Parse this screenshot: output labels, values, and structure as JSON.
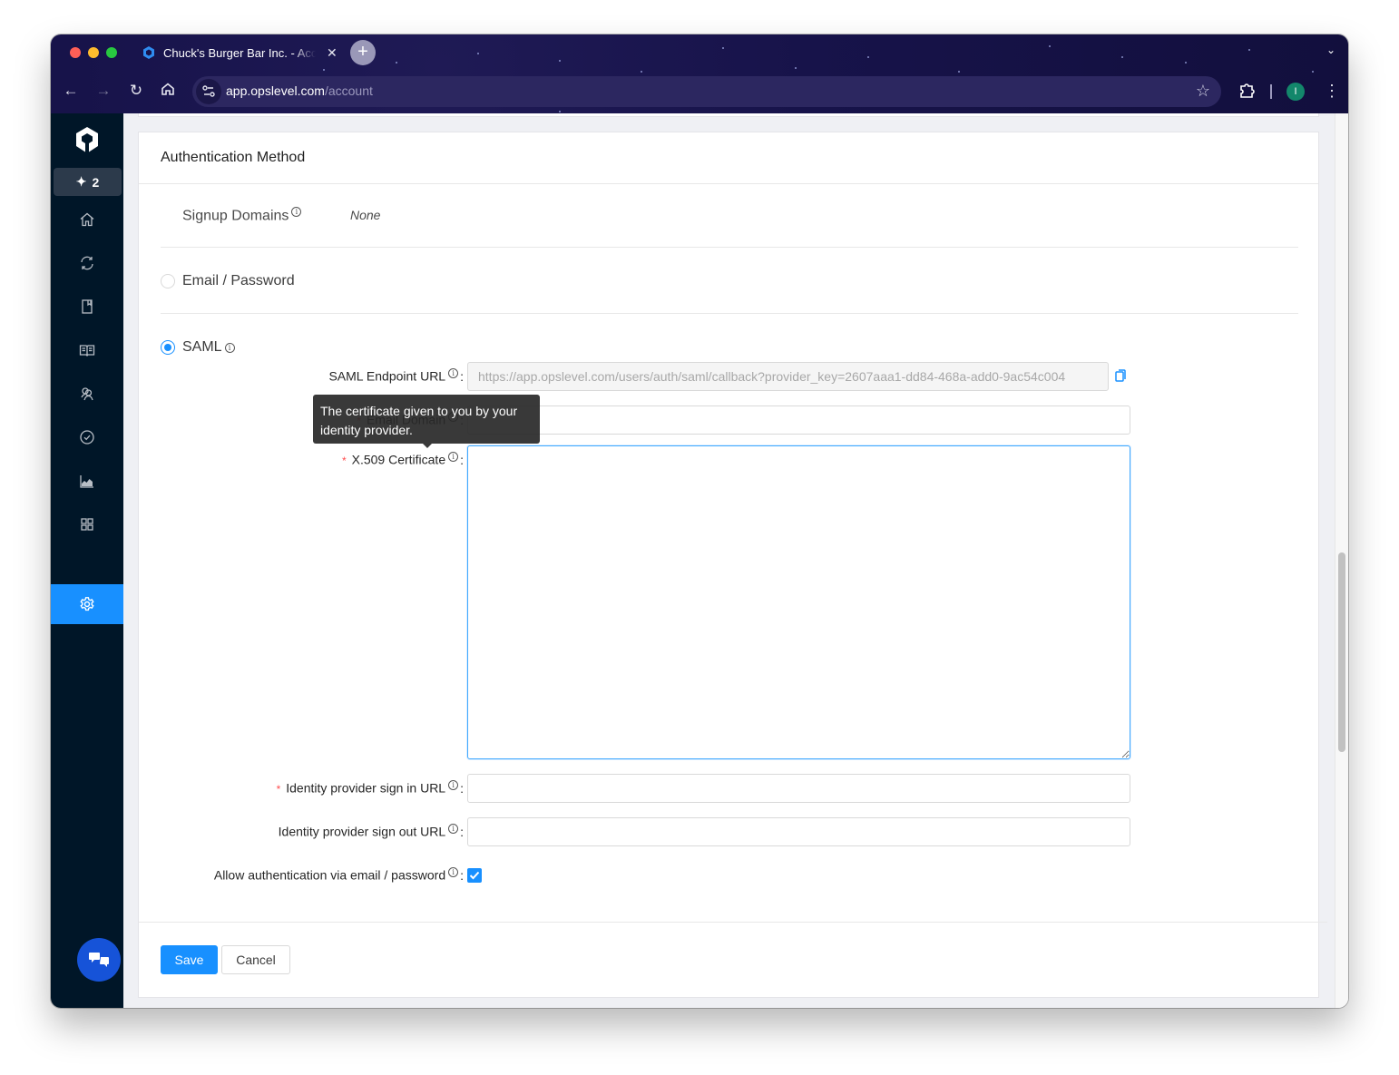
{
  "browser": {
    "tab_title": "Chuck's Burger Bar Inc. - Account",
    "url_domain": "app.opslevel.com",
    "url_path": "/account",
    "profile_initial": "I",
    "new_tab_label": "+"
  },
  "sidebar": {
    "ai_badge_count": "2",
    "items": [
      {
        "name": "home",
        "label": "Home"
      },
      {
        "name": "sync",
        "label": "Repositories"
      },
      {
        "name": "catalog",
        "label": "Catalog"
      },
      {
        "name": "docs",
        "label": "Documentation"
      },
      {
        "name": "teams",
        "label": "Teams"
      },
      {
        "name": "checks",
        "label": "Checks"
      },
      {
        "name": "reports",
        "label": "Reports"
      },
      {
        "name": "integrations",
        "label": "Integrations"
      },
      {
        "name": "settings",
        "label": "Settings",
        "active": true
      }
    ]
  },
  "auth": {
    "title": "Authentication Method",
    "signup_domains_label": "Signup Domains",
    "signup_domains_value": "None",
    "options": [
      {
        "label": "Email / Password",
        "selected": false
      },
      {
        "label": "SAML",
        "selected": true
      }
    ],
    "saml": {
      "endpoint_label": "SAML Endpoint URL",
      "endpoint_value": "https://app.opslevel.com/users/auth/saml/callback?provider_key=2607aaa1-dd84-468a-add0-9ac54c004",
      "email_domain_label": "Email Domain",
      "email_domain_value": "",
      "certificate_label": "X.509 Certificate",
      "certificate_value": "",
      "certificate_tooltip": "The certificate given to you by your identity provider.",
      "sign_in_label": "Identity provider sign in URL",
      "sign_in_value": "",
      "sign_out_label": "Identity provider sign out URL",
      "sign_out_value": "",
      "allow_password_label": "Allow authentication via email / password",
      "allow_password_checked": true
    },
    "save_label": "Save",
    "cancel_label": "Cancel"
  },
  "colors": {
    "accent": "#1890ff",
    "sidebar_bg": "#001628",
    "required": "#ff4d4f"
  }
}
